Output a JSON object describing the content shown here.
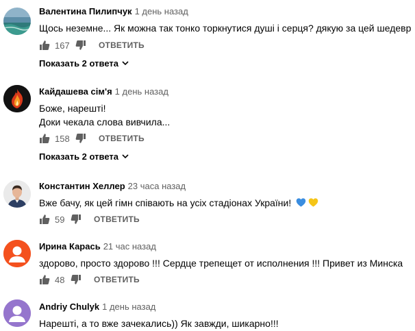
{
  "comments": [
    {
      "author": "Валентина Пилипчук",
      "time": "1 день назад",
      "lines": [
        "Щось неземне... Як можна так тонко торкнутися душі і серця? дякую за цей шедевр"
      ],
      "likes": "167",
      "reply_label": "ОТВЕТИТЬ",
      "replies_label": "Показать 2 ответа",
      "avatar_icon": "sea-landscape-avatar"
    },
    {
      "author": "Кайдашева сім'я",
      "time": "1 день назад",
      "lines": [
        "Боже, нарешті!",
        "Доки чекала слова вивчила..."
      ],
      "likes": "158",
      "reply_label": "ОТВЕТИТЬ",
      "replies_label": "Показать 2 ответа",
      "avatar_icon": "fire-avatar"
    },
    {
      "author": "Константин Хеллер",
      "time": "23 часа назад",
      "lines": [
        "Вже бачу, як цей гімн співають на усіх стадіонах України!"
      ],
      "emoji": [
        "blue-heart-icon",
        "yellow-heart-icon"
      ],
      "likes": "59",
      "reply_label": "ОТВЕТИТЬ",
      "avatar_icon": "person-photo-avatar"
    },
    {
      "author": "Ирина Карась",
      "time": "21 час назад",
      "lines": [
        "здорово, просто здорово !!! Сердце трепещет от исполнения !!! Привет из Минска"
      ],
      "likes": "48",
      "reply_label": "ОТВЕТИТЬ",
      "avatar_icon": "default-user-avatar",
      "avatar_color": "#f4511e"
    },
    {
      "author": "Andriy Chulyk",
      "time": "1 день назад",
      "lines": [
        "Нарешті, а то вже зачекались)) Як завжди, шикарно!!!"
      ],
      "avatar_icon": "default-user-avatar",
      "avatar_color": "#9575cd"
    }
  ],
  "colors": {
    "meta_gray": "#606060",
    "text": "#030303",
    "blue_heart": "#3a8de0",
    "yellow_heart": "#f5c518"
  }
}
